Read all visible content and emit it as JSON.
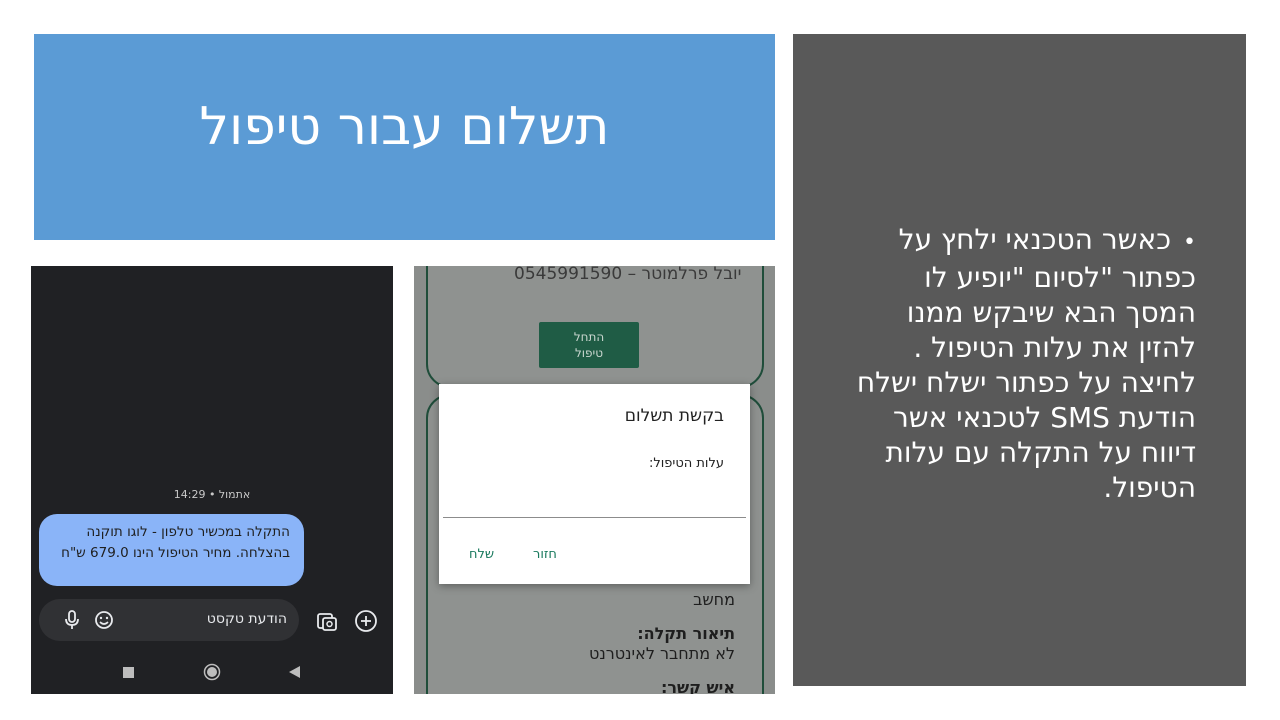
{
  "slide": {
    "title": "תשלום עבור טיפול",
    "bullet_lines": [
      "כאשר הטכנאי ילחץ על",
      "כפתור \"לסיום \"יופיע לו",
      "המסך הבא שיבקש ממנו",
      "להזין את עלות הטיפול .",
      "לחיצה על כפתור ישלח ישלח",
      "הודעת SMS לטכנאי אשר",
      "דיווח על התקלה עם עלות",
      "הטיפול."
    ]
  },
  "sms_screen": {
    "timestamp": "אתמול • 14:29",
    "message_line1": "התקלה במכשיר טלפון - לוגו תוקנה",
    "message_line2": "בהצלחה. מחיר הטיפול הינו 679.0 ש\"ח",
    "input_placeholder": "הודעת טקסט",
    "icons": [
      "mic-icon",
      "emoji-icon",
      "gallery-icon",
      "add-icon",
      "nav-square-icon",
      "nav-home-icon",
      "nav-back-icon"
    ]
  },
  "app_screen": {
    "contact_line": "יובל פרלמוטר – 0545991590",
    "start_button_line1": "התחל",
    "start_button_line2": "טיפול",
    "device_value": "מחשב",
    "issue_label": "תיאור תקלה:",
    "issue_value": "לא מתחבר לאינטרנט",
    "contact_label": "איש קשר:",
    "dialog": {
      "title": "בקשת תשלום",
      "cost_label": "עלות הטיפול:",
      "back_button": "חזור",
      "send_button": "שלח"
    }
  },
  "colors": {
    "title_bg": "#5b9bd5",
    "panel_bg": "#595959",
    "bubble_bg": "#8ab4f8",
    "app_button": "#1f5c45"
  }
}
